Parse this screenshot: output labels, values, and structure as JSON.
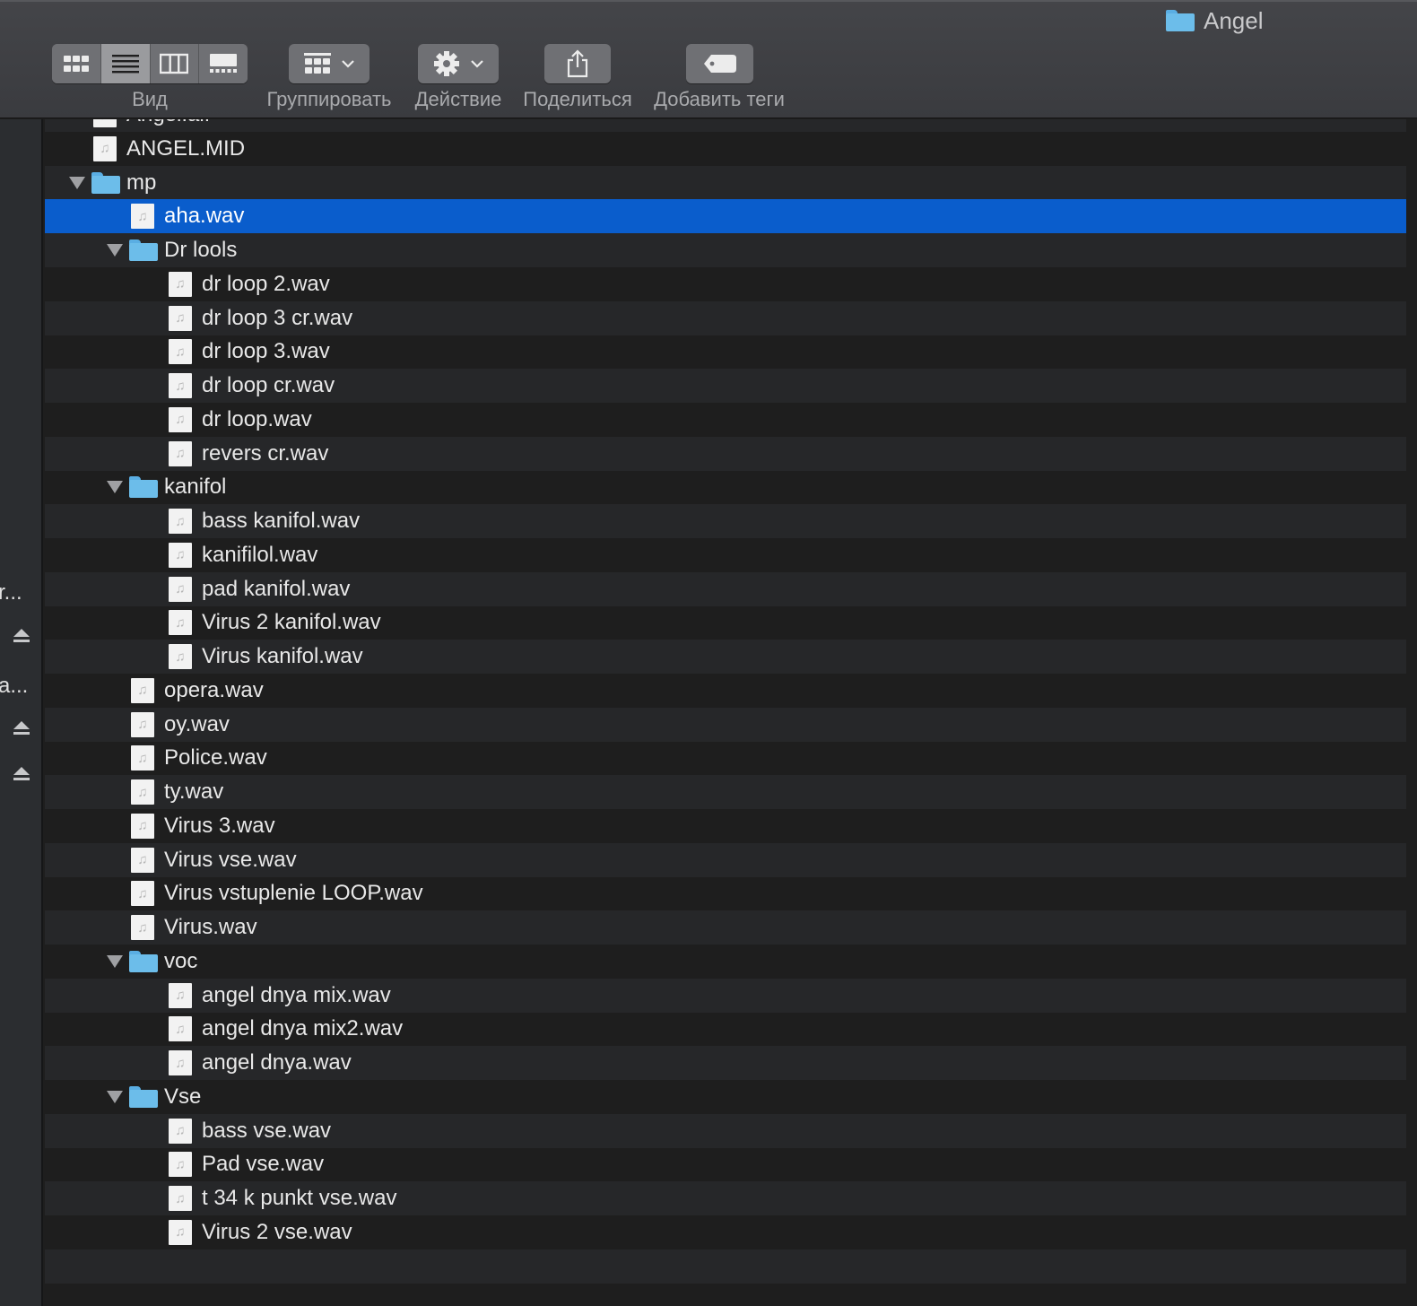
{
  "window": {
    "title": "Angel",
    "title_icon": "folder-icon"
  },
  "toolbar": {
    "view_label": "Вид",
    "group_label": "Группировать",
    "action_label": "Действие",
    "share_label": "Поделиться",
    "tags_label": "Добавить теги",
    "view_modes": [
      "icons-view-icon",
      "list-view-icon",
      "columns-view-icon",
      "gallery-view-icon"
    ],
    "active_view_mode": "list"
  },
  "sidebar": {
    "truncated_items": [
      "r...",
      "a..."
    ],
    "eject_icons": 3
  },
  "colors": {
    "selection": "#0a5dcc",
    "folder": "#6cbdea",
    "toolbar": "#3f4044"
  },
  "file_list": {
    "rows": [
      {
        "name": "Angel.aif",
        "type": "file",
        "level": 0,
        "partial": true
      },
      {
        "name": "ANGEL.MID",
        "type": "file",
        "level": 0
      },
      {
        "name": "mp",
        "type": "folder",
        "level": 0,
        "expanded": true
      },
      {
        "name": "aha.wav",
        "type": "file",
        "level": 1,
        "selected": true
      },
      {
        "name": "Dr lools",
        "type": "folder",
        "level": 1,
        "expanded": true
      },
      {
        "name": "dr loop 2.wav",
        "type": "file",
        "level": 2
      },
      {
        "name": "dr loop 3 cr.wav",
        "type": "file",
        "level": 2
      },
      {
        "name": "dr loop 3.wav",
        "type": "file",
        "level": 2
      },
      {
        "name": "dr loop cr.wav",
        "type": "file",
        "level": 2
      },
      {
        "name": "dr loop.wav",
        "type": "file",
        "level": 2
      },
      {
        "name": "revers cr.wav",
        "type": "file",
        "level": 2
      },
      {
        "name": "kanifol",
        "type": "folder",
        "level": 1,
        "expanded": true
      },
      {
        "name": "bass kanifol.wav",
        "type": "file",
        "level": 2
      },
      {
        "name": "kanifilol.wav",
        "type": "file",
        "level": 2
      },
      {
        "name": "pad kanifol.wav",
        "type": "file",
        "level": 2
      },
      {
        "name": "Virus 2 kanifol.wav",
        "type": "file",
        "level": 2
      },
      {
        "name": "Virus kanifol.wav",
        "type": "file",
        "level": 2
      },
      {
        "name": "opera.wav",
        "type": "file",
        "level": 1
      },
      {
        "name": "oy.wav",
        "type": "file",
        "level": 1
      },
      {
        "name": "Police.wav",
        "type": "file",
        "level": 1
      },
      {
        "name": "ty.wav",
        "type": "file",
        "level": 1
      },
      {
        "name": "Virus 3.wav",
        "type": "file",
        "level": 1
      },
      {
        "name": "Virus vse.wav",
        "type": "file",
        "level": 1
      },
      {
        "name": "Virus vstuplenie LOOP.wav",
        "type": "file",
        "level": 1
      },
      {
        "name": "Virus.wav",
        "type": "file",
        "level": 1
      },
      {
        "name": "voc",
        "type": "folder",
        "level": 1,
        "expanded": true
      },
      {
        "name": "angel dnya mix.wav",
        "type": "file",
        "level": 2
      },
      {
        "name": "angel dnya mix2.wav",
        "type": "file",
        "level": 2
      },
      {
        "name": "angel dnya.wav",
        "type": "file",
        "level": 2
      },
      {
        "name": "Vse",
        "type": "folder",
        "level": 1,
        "expanded": true
      },
      {
        "name": "bass vse.wav",
        "type": "file",
        "level": 2
      },
      {
        "name": "Pad vse.wav",
        "type": "file",
        "level": 2
      },
      {
        "name": "t 34 k punkt vse.wav",
        "type": "file",
        "level": 2
      },
      {
        "name": "Virus 2 vse.wav",
        "type": "file",
        "level": 2
      }
    ]
  }
}
